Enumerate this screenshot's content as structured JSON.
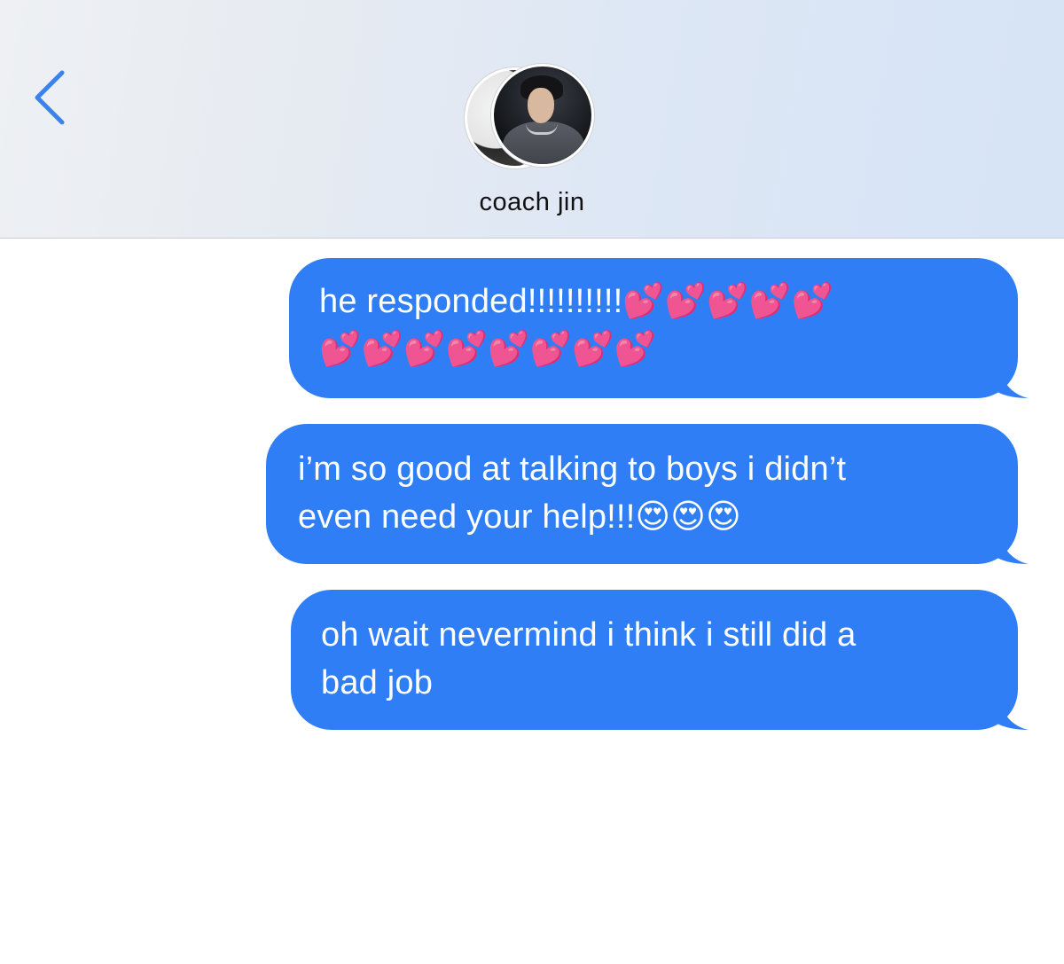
{
  "header": {
    "back_icon": "chevron-left-icon",
    "contact_name": "coach jin",
    "accent_color": "#3b82f0"
  },
  "messages": [
    {
      "sender": "me",
      "text": "he responded!!!!!!!!!!💕💕💕💕💕\n💕💕💕💕💕💕💕💕"
    },
    {
      "sender": "me",
      "text": "i’m so good at talking to boys i didn’t\neven need your help!!!😍😍😍"
    },
    {
      "sender": "me",
      "text": "oh wait nevermind i think i still did a\nbad job"
    }
  ],
  "colors": {
    "bubble": "#2f7ef5",
    "bubble_text": "#ffffff"
  }
}
